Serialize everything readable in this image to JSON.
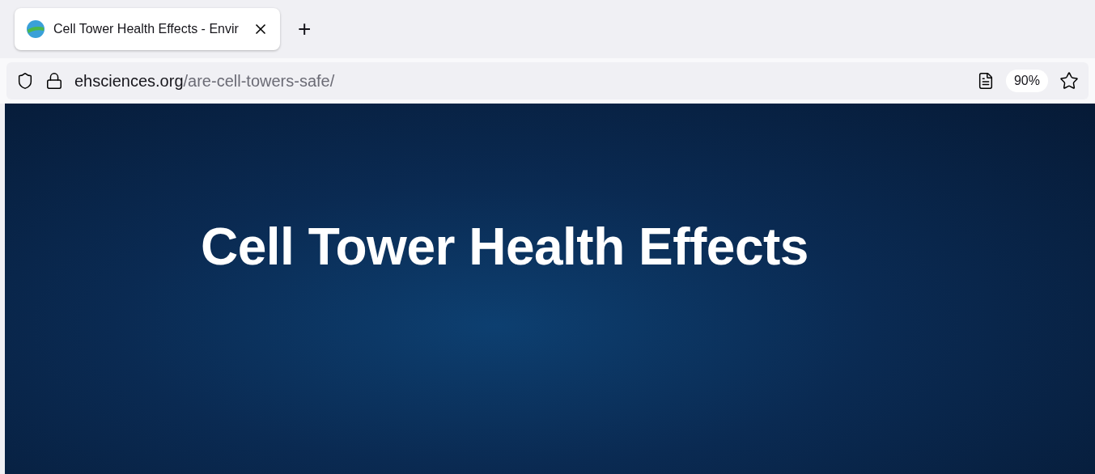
{
  "browser": {
    "tabs": [
      {
        "title": "Cell Tower Health Effects - Envir",
        "selected": true
      }
    ],
    "new_tab_label": "+",
    "address": {
      "domain": "ehsciences.org",
      "path": "/are-cell-towers-safe/"
    },
    "zoom": "90%"
  },
  "page": {
    "hero_title": "Cell Tower Health Effects"
  }
}
